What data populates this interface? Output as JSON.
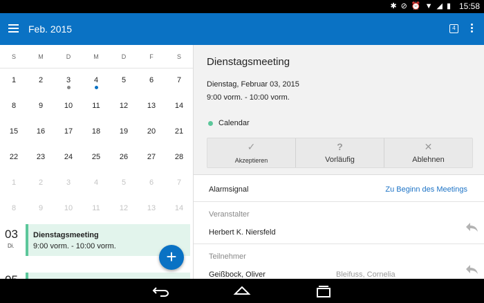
{
  "status_bar": {
    "time": "15:58",
    "icons": [
      "bluetooth-icon",
      "mute-icon",
      "alarm-icon",
      "wifi-icon",
      "signal-icon",
      "battery-icon"
    ]
  },
  "app_bar": {
    "title": "Feb. 2015",
    "today_number": "4",
    "accent_color": "#0a72c4"
  },
  "calendar": {
    "weekdays": [
      "S",
      "M",
      "D",
      "M",
      "D",
      "F",
      "S"
    ],
    "weeks": [
      [
        "1",
        "2",
        "3",
        "4",
        "5",
        "6",
        "7"
      ],
      [
        "8",
        "9",
        "10",
        "11",
        "12",
        "13",
        "14"
      ],
      [
        "15",
        "16",
        "17",
        "18",
        "19",
        "20",
        "21"
      ],
      [
        "22",
        "23",
        "24",
        "25",
        "26",
        "27",
        "28"
      ],
      [
        "1",
        "2",
        "3",
        "4",
        "5",
        "6",
        "7"
      ],
      [
        "8",
        "9",
        "10",
        "11",
        "12",
        "13",
        "14"
      ]
    ],
    "faded_weeks": [
      4,
      5
    ],
    "event_dots": [
      {
        "week": 0,
        "day": 2,
        "color": "gray"
      },
      {
        "week": 0,
        "day": 3,
        "color": "blue"
      }
    ]
  },
  "agenda": {
    "day_number": "03",
    "day_name": "Di.",
    "event_title": "Dienstagsmeeting",
    "event_time": "9:00 vorm. - 10:00 vorm.",
    "next_day_number": "05",
    "event_color": "#5cc79b"
  },
  "detail": {
    "title": "Dienstagsmeeting",
    "date": "Dienstag, Februar 03, 2015",
    "time": "9:00 vorm. - 10:00 vorm.",
    "calendar_name": "Calendar",
    "responses": {
      "accept_label": "Akzeptieren",
      "tentative_label": "Vorläufig",
      "decline_label": "Ablehnen"
    },
    "alarm_label": "Alarmsignal",
    "alarm_value": "Zu Beginn des Meetings",
    "organizer_label": "Veranstalter",
    "organizer_name": "Herbert K. Niersfeld",
    "attendees_label": "Teilnehmer",
    "attendee_1": "Geißbock, Oliver",
    "attendee_2": "Bleifuss, Cornelia"
  }
}
